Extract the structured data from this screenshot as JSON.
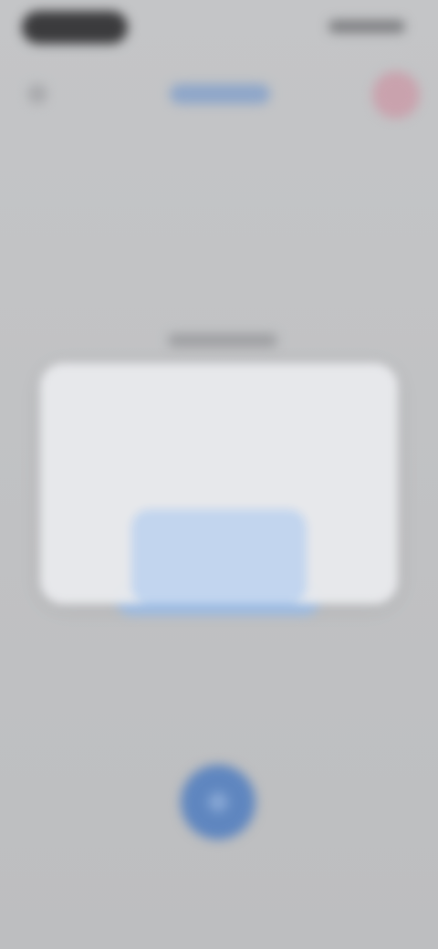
{
  "status_bar": {
    "time": "",
    "indicators": ""
  },
  "nav": {
    "title": "",
    "back_icon": "chevron-left-icon",
    "avatar_icon": "user-avatar-icon"
  },
  "background": {
    "section_label": "",
    "cta_label": ""
  },
  "dialog": {
    "title": "",
    "body": "",
    "cancel_label": "",
    "confirm_label": ""
  },
  "fab": {
    "icon": "microphone-icon",
    "color": "#5f86bf"
  },
  "colors": {
    "accent": "#5f86bf",
    "overlay": "#bfc0c2",
    "dialog_bg": "#e8e9ec"
  }
}
